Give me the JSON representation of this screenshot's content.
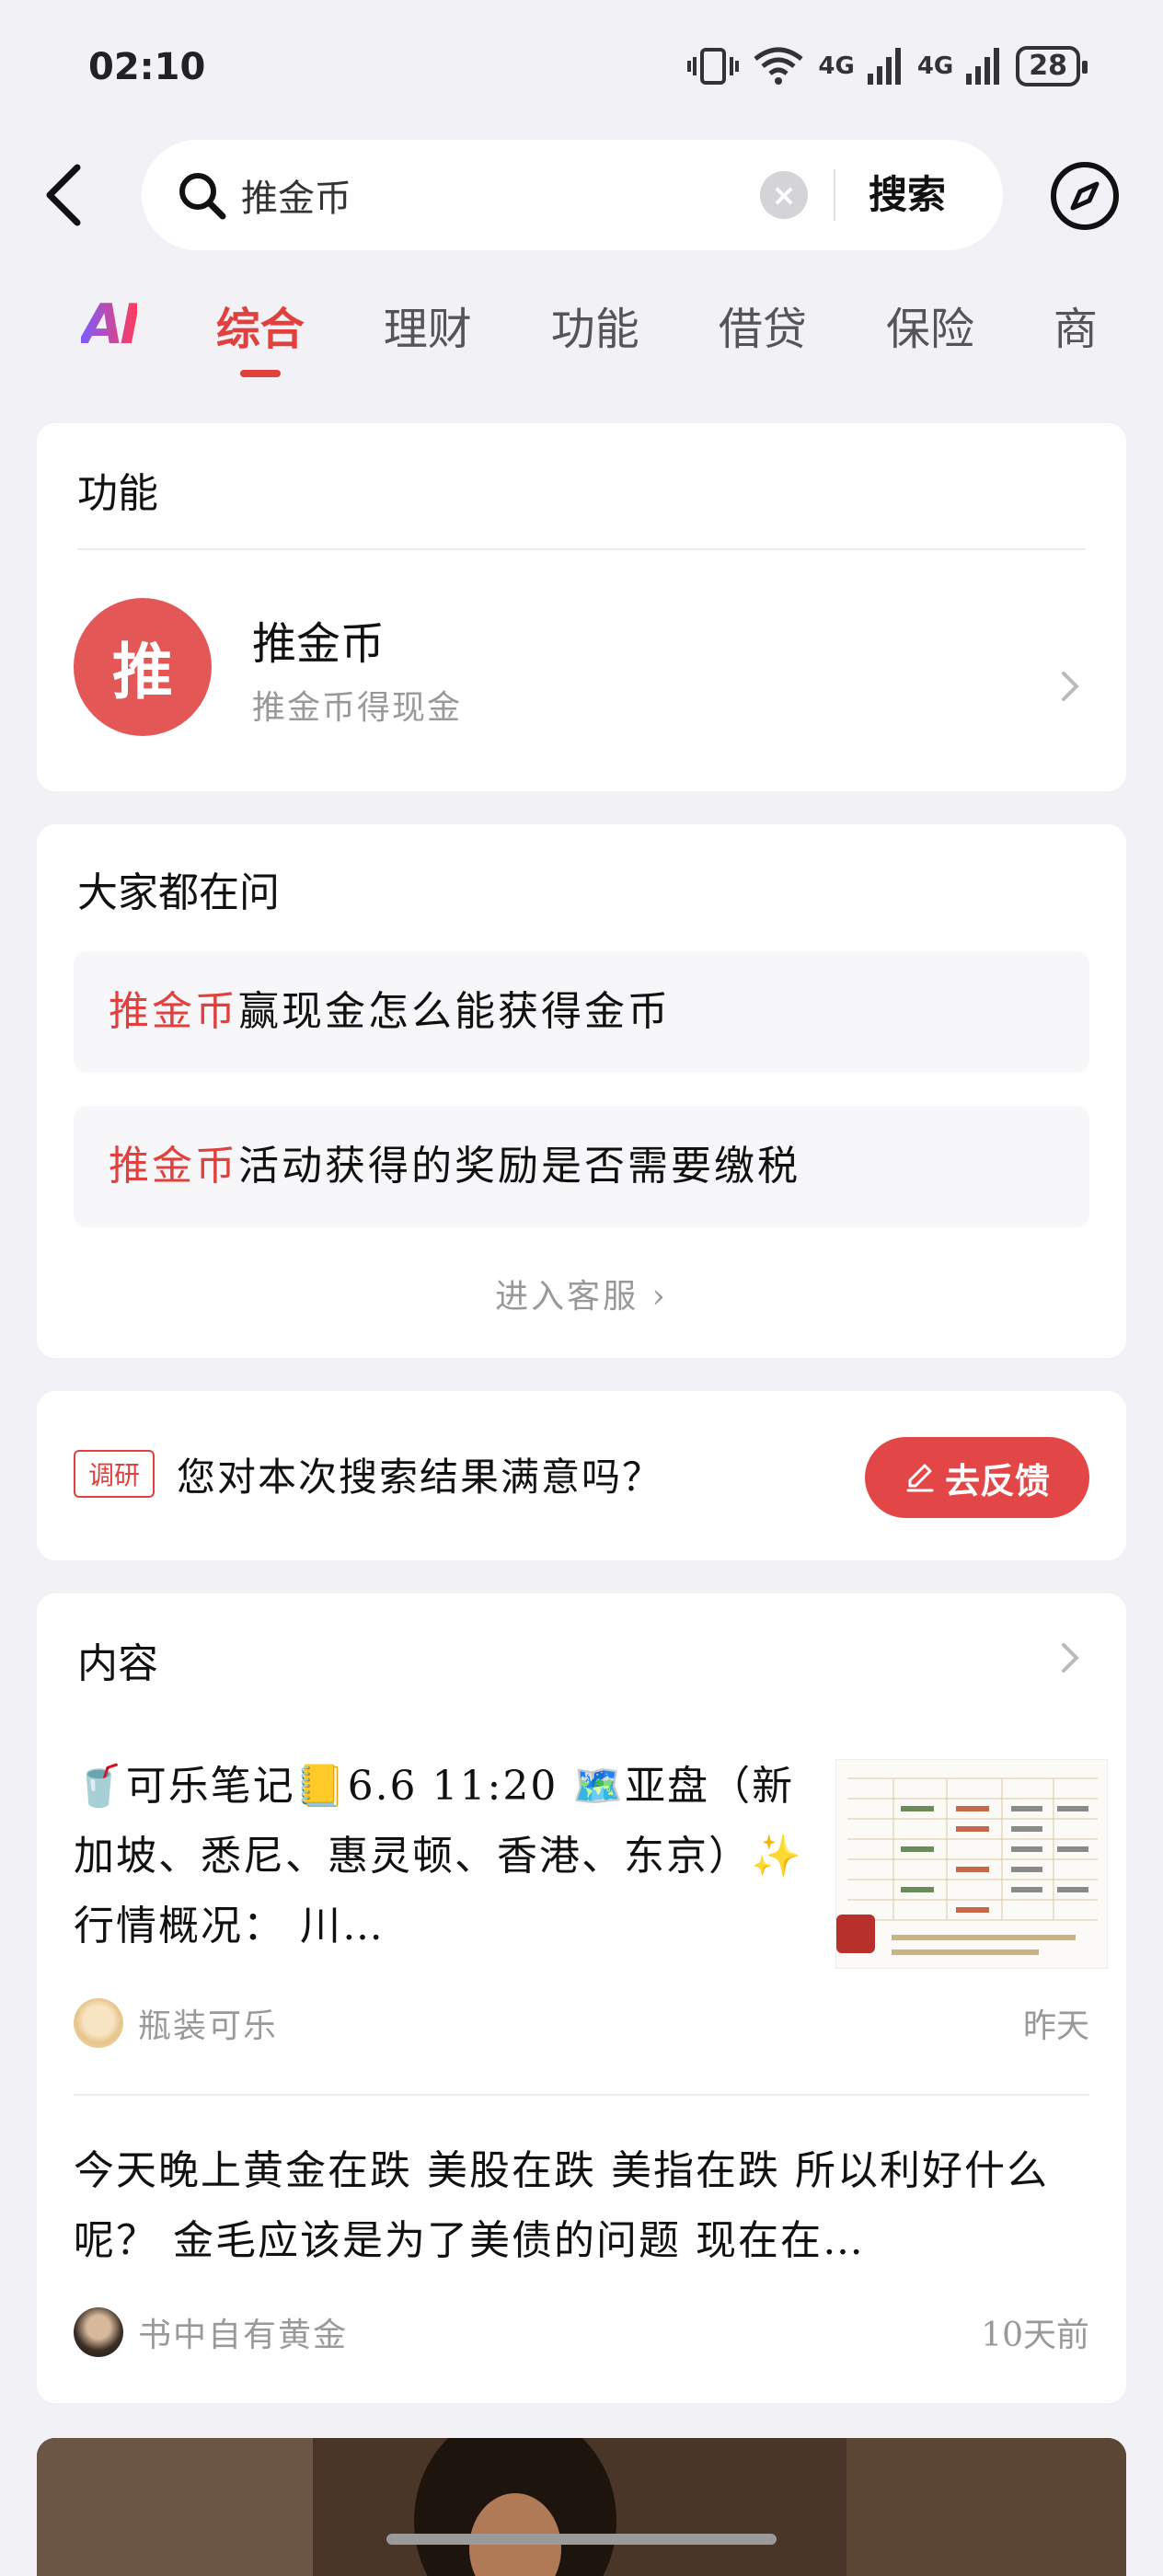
{
  "status_bar": {
    "time": "02:10",
    "network1": "4G",
    "network2": "4G",
    "battery": "28"
  },
  "search": {
    "query": "推金币",
    "button_label": "搜索"
  },
  "tabs": [
    {
      "label": "综合",
      "active": true
    },
    {
      "label": "理财"
    },
    {
      "label": "功能"
    },
    {
      "label": "借贷"
    },
    {
      "label": "保险"
    },
    {
      "label": "商"
    }
  ],
  "function_section": {
    "title": "功能",
    "item": {
      "avatar_char": "推",
      "name": "推金币",
      "desc": "推金币得现金"
    }
  },
  "ask_section": {
    "title": "大家都在问",
    "items": [
      {
        "keyword": "推金币",
        "text": "赢现金怎么能获得金币"
      },
      {
        "keyword": "推金币",
        "text": "活动获得的奖励是否需要缴税"
      }
    ],
    "more_label": "进入客服"
  },
  "survey": {
    "tag": "调研",
    "text": "您对本次搜索结果满意吗？",
    "button_label": "去反馈"
  },
  "content_section": {
    "title": "内容",
    "posts": [
      {
        "text": "🥤可乐笔记📒6.6 11:20 🗺️亚盘（新加坡、悉尼、惠灵顿、香港、东京）✨行情概况： 川…",
        "author": "瓶装可乐",
        "time": "昨天"
      },
      {
        "text": "今天晚上黄金在跌 美股在跌 美指在跌 所以利好什么呢？ 金毛应该是为了美债的问题 现在在…",
        "author": "书中自有黄金",
        "time": "10天前"
      }
    ]
  },
  "colors": {
    "accent": "#e0413f",
    "background": "#f2f2f6"
  }
}
